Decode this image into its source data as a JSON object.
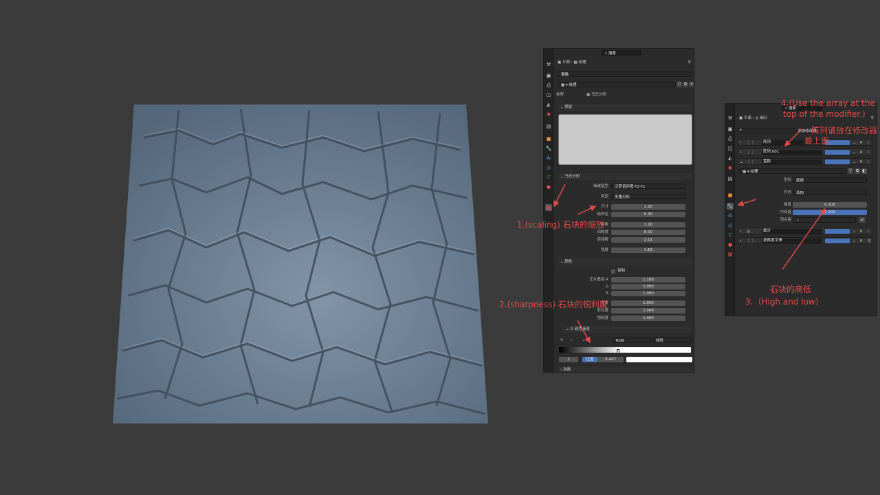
{
  "viewport": {
    "surface_color": "#7e90a2"
  },
  "texture_panel": {
    "search_placeholder": "搜索",
    "breadcrumb": {
      "object": "平面",
      "item": "纹理"
    },
    "slot_dropdown": "置换",
    "texture_name": "纹理",
    "type_label": "类型",
    "type_value": "马氏分形",
    "preview_header": "预览",
    "musgrave_header": "马氏分形",
    "noise_basis_label": "噪波基型",
    "noise_basis_value": "沃罗诺伊图 F2-F1",
    "noise_type_label": "类型",
    "noise_type_value": "多重分形",
    "params": [
      {
        "label": "尺寸",
        "value": "1.20"
      },
      {
        "label": "纳布拉",
        "value": "0.30"
      },
      {
        "label": "维数",
        "value": "1.20"
      },
      {
        "label": "间隙度",
        "value": "6.00"
      },
      {
        "label": "倍频程",
        "value": "2.11"
      }
    ],
    "intensity_label": "强度",
    "intensity_value": "1.63",
    "colors_header": "颜色",
    "clamp_label": "钳制",
    "rgb_params": [
      {
        "label": "正片叠底 R",
        "value": "1.180"
      },
      {
        "label": "G",
        "value": "1.000"
      },
      {
        "label": "B",
        "value": "1.000"
      }
    ],
    "adjust_params": [
      {
        "label": "亮度",
        "value": "1.000"
      },
      {
        "label": "对比度",
        "value": "1.000"
      },
      {
        "label": "饱和度",
        "value": "1.000"
      }
    ],
    "ramp_header": "颜色渐变",
    "ramp_plus": "+",
    "ramp_minus": "−",
    "ramp_mode": "RGB",
    "ramp_interp": "线性",
    "stop_index": "1",
    "position_label": "位置",
    "position_value": "0.447",
    "anim_header": "动画"
  },
  "modifier_panel": {
    "search_placeholder": "搜索",
    "breadcrumb": {
      "object": "平面",
      "item": "细分"
    },
    "add_modifier": "添加修改器",
    "modifiers": [
      "阵列",
      "阵列.001",
      "置换"
    ],
    "texture_name": "纹理",
    "coord_label": "坐标",
    "coord_value": "局部",
    "direction_label": "方向",
    "direction_value": "法向",
    "strength_label": "强度",
    "strength_value": "0.100",
    "midlevel_label": "中间值",
    "midlevel_value": "1.000",
    "vertex_group_label": "顶点组",
    "bottom_modifiers": [
      "细分",
      "按角度平滑"
    ]
  },
  "annotations": {
    "a1": "1.(scaling) 石块的缩放",
    "a2": "2.(sharpness)  石块的锐利度",
    "a3_cn": "石块的高低",
    "a3_en": "3.（High and low）",
    "a4_line1": "4.(Use the array at the",
    "a4_line2": "top of the modifier.)",
    "a4_cn1": "阵列请放在修改器",
    "a4_cn2": "最上面"
  },
  "colors": {
    "annotation": "#e24a4a",
    "accent": "#4a74b8",
    "panel_bg": "#2b2b2b"
  }
}
